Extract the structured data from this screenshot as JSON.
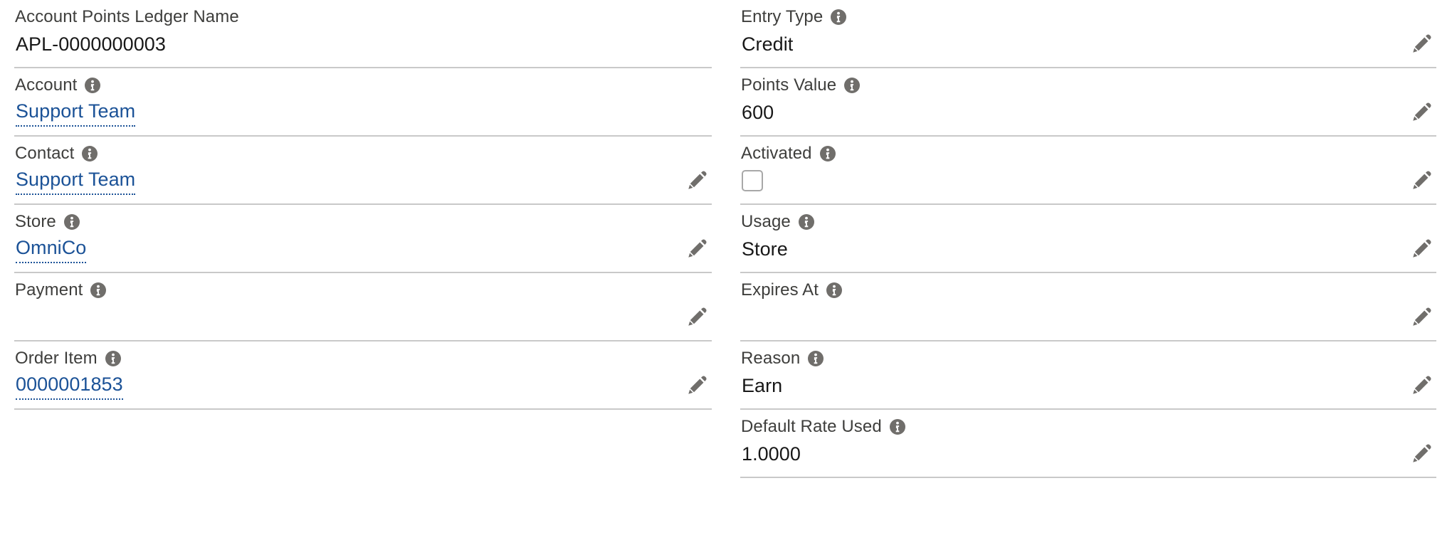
{
  "theme": {
    "label_color": "#3e3e3c",
    "value_color": "#181818",
    "link_color": "#1b5297",
    "separator_color": "#c9c9c9",
    "info_icon_color": "#706e6b",
    "pencil_icon_color": "#706e6b",
    "background": "#ffffff"
  },
  "icons": {
    "info": "info-icon",
    "edit": "pencil-icon",
    "checkbox": "checkbox-unchecked-icon"
  },
  "left_column": {
    "fields": [
      {
        "label": "Account Points Ledger Name",
        "has_info_icon": false,
        "value": "APL-0000000003",
        "value_type": "text",
        "editable": false
      },
      {
        "label": "Account",
        "has_info_icon": true,
        "value": "Support Team",
        "value_type": "link",
        "editable": false
      },
      {
        "label": "Contact",
        "has_info_icon": true,
        "value": "Support Team",
        "value_type": "link",
        "editable": true
      },
      {
        "label": "Store",
        "has_info_icon": true,
        "value": "OmniCo",
        "value_type": "link",
        "editable": true
      },
      {
        "label": "Payment",
        "has_info_icon": true,
        "value": "",
        "value_type": "text",
        "editable": true
      },
      {
        "label": "Order Item",
        "has_info_icon": true,
        "value": "0000001853",
        "value_type": "link",
        "editable": true
      }
    ]
  },
  "right_column": {
    "fields": [
      {
        "label": "Entry Type",
        "has_info_icon": true,
        "value": "Credit",
        "value_type": "text",
        "editable": true
      },
      {
        "label": "Points Value",
        "has_info_icon": true,
        "value": "600",
        "value_type": "text",
        "editable": true
      },
      {
        "label": "Activated",
        "has_info_icon": true,
        "value": "",
        "value_type": "checkbox",
        "checked": false,
        "editable": true
      },
      {
        "label": "Usage",
        "has_info_icon": true,
        "value": "Store",
        "value_type": "text",
        "editable": true
      },
      {
        "label": "Expires At",
        "has_info_icon": true,
        "value": "",
        "value_type": "text",
        "editable": true
      },
      {
        "label": "Reason",
        "has_info_icon": true,
        "value": "Earn",
        "value_type": "text",
        "editable": true
      },
      {
        "label": "Default Rate Used",
        "has_info_icon": true,
        "value": "1.0000",
        "value_type": "text",
        "editable": true
      }
    ]
  }
}
